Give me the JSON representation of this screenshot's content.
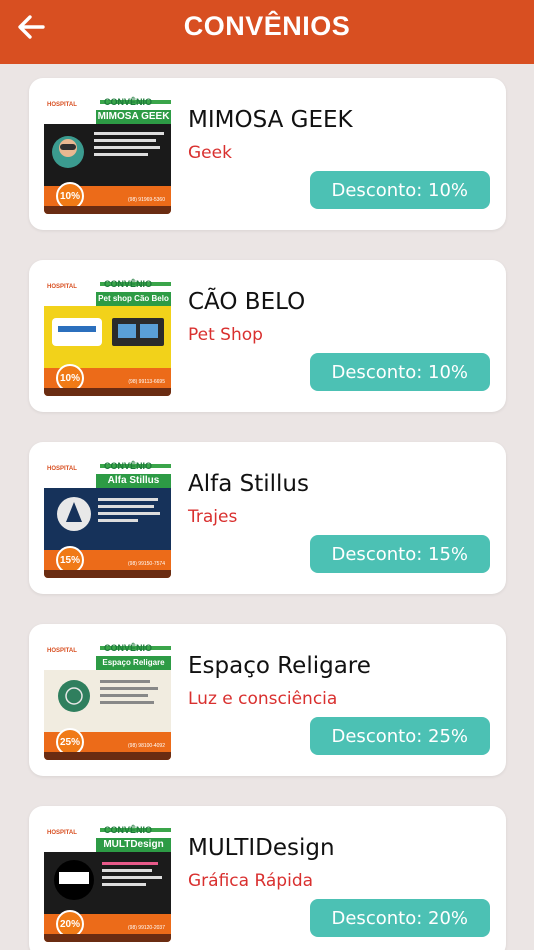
{
  "header": {
    "title": "CONVÊNIOS",
    "back_icon": "arrow-left-icon"
  },
  "colors": {
    "header": "#d84f21",
    "discount": "#4cc1b4",
    "category": "#d9302f"
  },
  "items": [
    {
      "name": "MIMOSA GEEK",
      "category": "Geek",
      "discount": "Desconto: 10%",
      "thumb": {
        "conv": "CONVÊNIO",
        "banner": "MIMOSA GEEK",
        "pct": "10%",
        "phone": "(98) 91969-5360",
        "bg": "#1a1a1a"
      }
    },
    {
      "name": "CÃO BELO",
      "category": "Pet Shop",
      "discount": "Desconto: 10%",
      "thumb": {
        "conv": "CONVÊNIO",
        "banner": "Pet shop Cão Belo",
        "pct": "10%",
        "phone": "(98) 99113-6695",
        "bg": "#f2d21a"
      }
    },
    {
      "name": "Alfa Stillus",
      "category": "Trajes",
      "discount": "Desconto: 15%",
      "thumb": {
        "conv": "CONVÊNIO",
        "banner": "Alfa Stillus",
        "pct": "15%",
        "phone": "(98) 99150-7574",
        "bg": "#16325a"
      }
    },
    {
      "name": "Espaço Religare",
      "category": "Luz e consciência",
      "discount": "Desconto: 25%",
      "thumb": {
        "conv": "CONVÊNIO",
        "banner": "Espaço Religare",
        "pct": "25%",
        "phone": "(98) 98100-4092",
        "bg": "#f1ece0"
      }
    },
    {
      "name": "MULTIDesign",
      "category": "Gráfica Rápida",
      "discount": "Desconto: 20%",
      "thumb": {
        "conv": "CONVÊNIO",
        "banner": "MULTDesign",
        "pct": "20%",
        "phone": "(98) 99120-2037",
        "bg": "#1b1b1b"
      }
    }
  ]
}
